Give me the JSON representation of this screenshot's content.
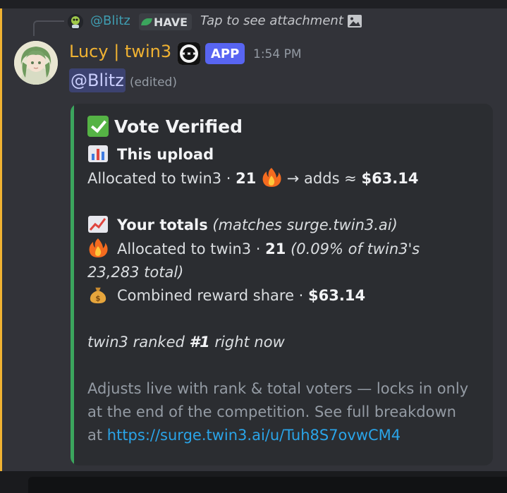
{
  "reply": {
    "user": "@Blitz",
    "tag": "HAVE",
    "text": "Tap to see attachment"
  },
  "message": {
    "author": "Lucy | twin3",
    "badge": "APP",
    "time": "1:54 PM",
    "mention": "@Blitz",
    "edited": "(edited)"
  },
  "embed": {
    "title": "Vote Verified",
    "upload_heading": "This upload",
    "upload_line_prefix": "Allocated to twin3 · ",
    "upload_count": "21",
    "upload_adds": "→ adds ≈ ",
    "upload_amount": "$63.14",
    "totals_heading": "Your totals",
    "totals_note": "(matches surge.twin3.ai)",
    "alloc_prefix": "Allocated to twin3 · ",
    "alloc_count": "21",
    "alloc_note_1": "(0.09% of twin3's",
    "alloc_note_2": "23,283 total)",
    "reward_prefix": "Combined reward share · ",
    "reward_amount": "$63.14",
    "rank_prefix": "twin3 ranked ",
    "rank_value": "#1",
    "rank_suffix": " right now",
    "footer_1": "Adjusts live with rank & total voters — locks in only",
    "footer_2": "at the end of the competition. See full breakdown",
    "footer_3_prefix": "at ",
    "footer_link": "https://surge.twin3.ai/u/Tuh8S7ovwCM4"
  },
  "colors": {
    "accent_green": "#3ba55d",
    "username_gold": "#f0b232",
    "app_badge": "#5865f2",
    "link": "#2aa4e8"
  }
}
